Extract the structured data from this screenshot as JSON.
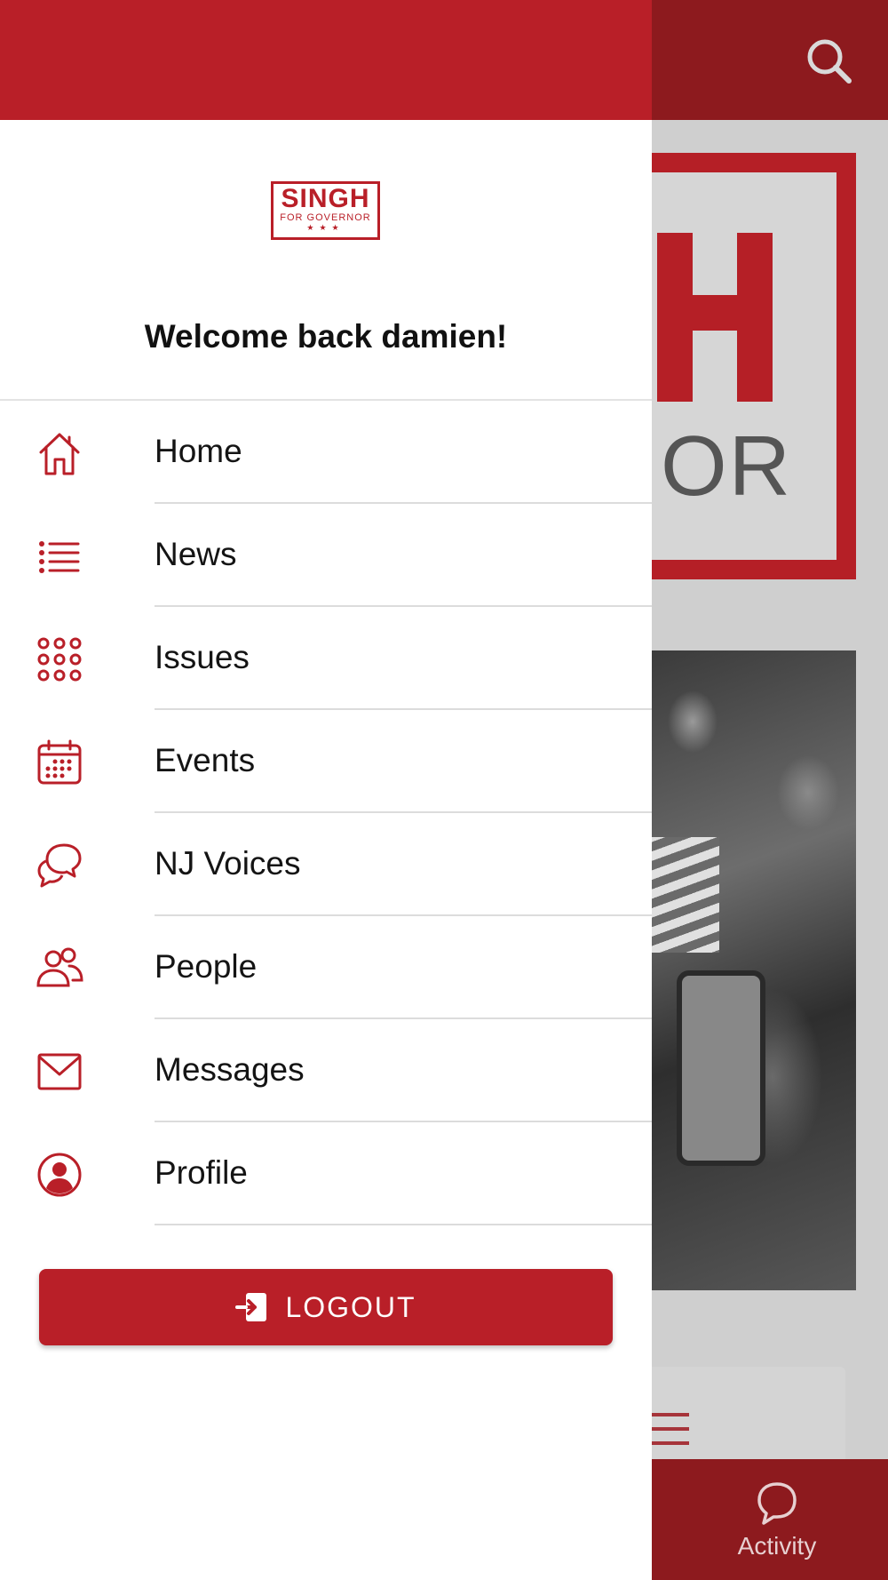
{
  "drawer": {
    "logo": {
      "main": "SINGH",
      "sub": "FOR GOVERNOR",
      "stars": "★★★"
    },
    "welcome": "Welcome back damien!",
    "menu": [
      {
        "label": "Home",
        "icon": "home-icon"
      },
      {
        "label": "News",
        "icon": "list-icon"
      },
      {
        "label": "Issues",
        "icon": "grid-icon"
      },
      {
        "label": "Events",
        "icon": "calendar-icon"
      },
      {
        "label": "NJ Voices",
        "icon": "chat-bubbles-icon"
      },
      {
        "label": "People",
        "icon": "people-icon"
      },
      {
        "label": "Messages",
        "icon": "envelope-icon"
      },
      {
        "label": "Profile",
        "icon": "user-circle-icon"
      }
    ],
    "logout_label": "LOGOUT"
  },
  "background": {
    "logo_text": "OR",
    "bottom_tab": {
      "label": "Activity",
      "icon": "chat-bubble-icon"
    }
  },
  "colors": {
    "accent": "#b91f28",
    "accent_dark": "#8d1a1e",
    "text": "#141414",
    "divider": "#dcdcdc"
  }
}
